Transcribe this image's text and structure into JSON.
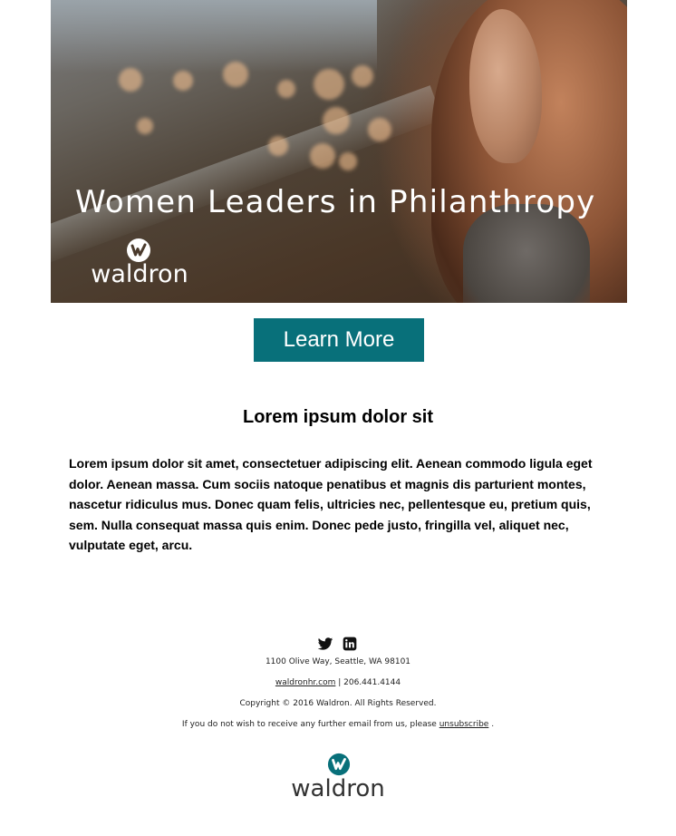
{
  "hero": {
    "title": "Women Leaders in Philanthropy",
    "logo_text": "waldron",
    "logo_icon": "waldron-w-icon"
  },
  "cta": {
    "label": "Learn More",
    "color": "#08707a"
  },
  "content": {
    "heading": "Lorem ipsum dolor sit",
    "body": "Lorem ipsum dolor sit amet, consectetuer adipiscing elit. Aenean commodo ligula eget dolor. Aenean massa. Cum sociis natoque penatibus et magnis dis parturient montes, nascetur ridiculus mus. Donec quam felis, ultricies nec, pellentesque eu, pretium quis, sem. Nulla consequat massa quis enim. Donec pede justo, fringilla vel, aliquet nec, vulputate eget, arcu."
  },
  "footer": {
    "social": [
      "twitter-icon",
      "linkedin-icon"
    ],
    "address": "1100 Olive Way, Seattle, WA 98101",
    "website": "waldronhr.com",
    "separator": " | ",
    "phone": "206.441.4144",
    "copyright": "Copyright © 2016 Waldron. All Rights Reserved.",
    "unsubscribe_prefix": "If you do not wish to receive any further email from us, please ",
    "unsubscribe_link": "unsubscribe",
    "unsubscribe_suffix": " .",
    "logo_text": "waldron",
    "logo_color": "#08707a"
  }
}
